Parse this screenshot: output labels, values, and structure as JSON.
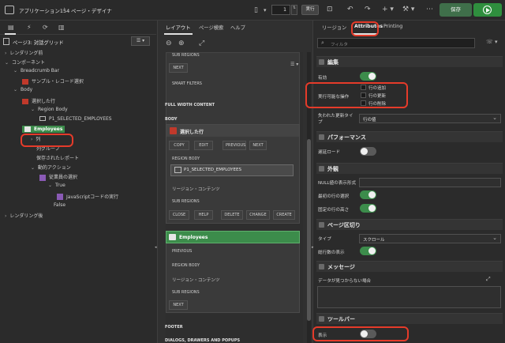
{
  "app": {
    "title": "アプリケーション154",
    "separator": "\\",
    "page_designer": "ページ・デザイナ",
    "page_number": "1",
    "run_label": "実行",
    "save_label": "保存"
  },
  "colors": {
    "accent_green": "#2f7d3e",
    "highlight_red": "#e53b2a",
    "green_card": "#3c8c4b"
  },
  "left": {
    "page_title": "ページ3: 対話グリッド",
    "tree": [
      {
        "label": "レンダリング前",
        "indent": 0,
        "icon": "chevron-right"
      },
      {
        "label": "コンポーネント",
        "indent": 0,
        "icon": "chevron-down"
      },
      {
        "label": "Breadcrumb Bar",
        "indent": 1,
        "icon": "chevron-down"
      },
      {
        "label": "サンプル・レコード選択",
        "indent": 2,
        "icon": "region"
      },
      {
        "label": "Body",
        "indent": 1,
        "icon": "chevron-down"
      },
      {
        "label": "選択した行",
        "indent": 2,
        "icon": "region"
      },
      {
        "label": "Region Body",
        "indent": 3,
        "icon": "chevron-down"
      },
      {
        "label": "P1_SELECTED_EMPLOYEES",
        "indent": 4,
        "icon": "item"
      },
      {
        "label": "Employees",
        "indent": 2,
        "icon": "grid"
      },
      {
        "label": "列",
        "indent": 3,
        "icon": "chevron-right"
      },
      {
        "label": "列グループ",
        "indent": 3,
        "icon": ""
      },
      {
        "label": "保存されたレポート",
        "indent": 3,
        "icon": ""
      },
      {
        "label": "動的アクション",
        "indent": 3,
        "icon": "chevron-down"
      },
      {
        "label": "従業員の選択",
        "indent": 4,
        "icon": "dynamic-action"
      },
      {
        "label": "True",
        "indent": 5,
        "icon": "chevron-down"
      },
      {
        "label": "JavaScriptコードの実行",
        "indent": 6,
        "icon": "js"
      },
      {
        "label": "False",
        "indent": 5,
        "icon": ""
      },
      {
        "label": "レンダリング後",
        "indent": 0,
        "icon": "chevron-right"
      }
    ]
  },
  "middle": {
    "tabs": [
      "レイアウト",
      "ページ検索",
      "ヘルプ"
    ],
    "sub_regions": "SUB REGIONS",
    "next": "NEXT",
    "smart_filters": "SMART FILTERS",
    "full_width_content": "FULL WIDTH CONTENT",
    "body": "BODY",
    "card1_title": "選択した行",
    "card1_buttons": [
      "COPY",
      "EDIT",
      "PREVIOUS",
      "NEXT"
    ],
    "region_body": "REGION BODY",
    "item": "P1_SELECTED_EMPLOYEES",
    "region_content": "リージョン・コンテンツ",
    "card1_sub_buttons": [
      "CLOSE",
      "HELP",
      "DELETE",
      "CHANGE",
      "CREATE"
    ],
    "card2_title": "Employees",
    "previous": "PREVIOUS",
    "footer": "FOOTER",
    "dialogs": "DIALOGS, DRAWERS AND POPUPS"
  },
  "right": {
    "tabs": [
      "リージョン",
      "Attributes",
      "Printing"
    ],
    "filter_placeholder": "フィルタ",
    "sections": {
      "edit": "編集",
      "performance": "パフォーマンス",
      "appearance": "外観",
      "pagination": "ページ区切り",
      "messages": "メッセージ",
      "toolbar": "ツールバー"
    },
    "enabled_label": "有効",
    "allowed_ops_label": "実行可能な操作",
    "ops": [
      "行の追加",
      "行の更新",
      "行の削除"
    ],
    "lost_update_label": "失われた更新タイプ",
    "lost_update_value": "行の値",
    "lazy_load_label": "遅延ロード",
    "null_display_label": "NULL値の表示形式",
    "select_first_row_label": "最初の行の選択",
    "fixed_row_height_label": "固定の行の高さ",
    "type_label": "タイプ",
    "type_value": "スクロール",
    "show_row_count_label": "総行数の表示",
    "no_data_label": "データが見つからない場合",
    "show_label": "表示"
  }
}
